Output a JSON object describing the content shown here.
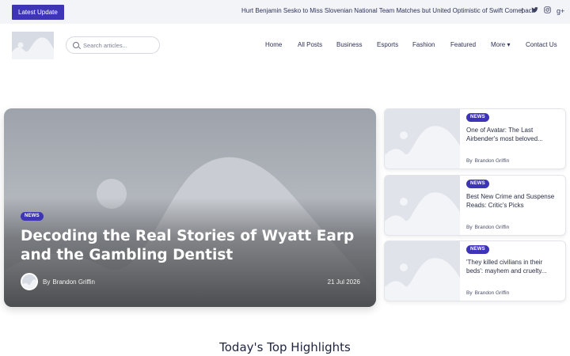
{
  "topbar": {
    "latest_label": "Latest Update",
    "ticker": "Hurt Benjamin Sesko to Miss Slovenian National Team Matches but United Optimistic of Swift Comeback",
    "social": [
      "f",
      "t",
      "i",
      "g+"
    ]
  },
  "search": {
    "placeholder": "Search articles..."
  },
  "nav": {
    "items": [
      "Home",
      "All Posts",
      "Business",
      "Esports",
      "Fashion",
      "Featured",
      "More ▾",
      "Contact Us"
    ]
  },
  "hero": {
    "badge": "NEWS",
    "title": "Decoding the Real Stories of Wyatt Earp and the Gambling Dentist",
    "by": "By",
    "author": "Brandon Griffin",
    "date": "21 Jul 2026"
  },
  "side_cards": [
    {
      "badge": "NEWS",
      "title": "One of Avatar: The Last Airbender's most beloved...",
      "by": "By",
      "author": "Brandon Griffin"
    },
    {
      "badge": "NEWS",
      "title": "Best New Crime and Suspense Reads: Critic's Picks",
      "by": "By",
      "author": "Brandon Griffin"
    },
    {
      "badge": "NEWS",
      "title": "'They killed civilians in their beds': mayhem and cruelty...",
      "by": "By",
      "author": "Brandon Griffin"
    }
  ],
  "section_title": "Today's Top Highlights",
  "colors": {
    "accent": "#3d35b5",
    "topbar_bg": "#f3f4f8",
    "placeholder_bg": "#d7dbe3"
  }
}
